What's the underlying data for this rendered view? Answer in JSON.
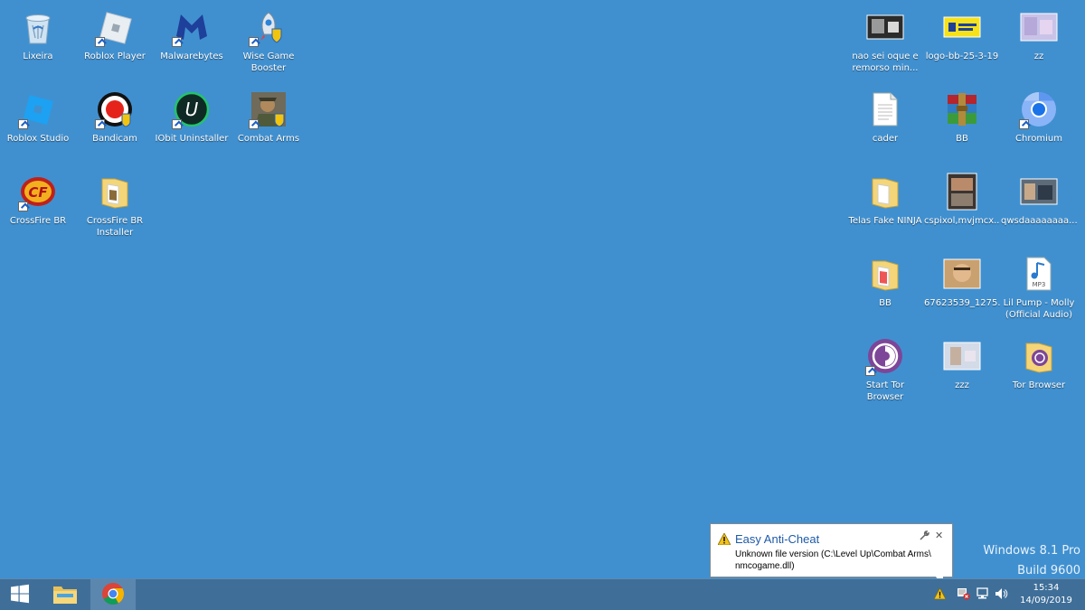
{
  "desktop": {
    "left_icons": [
      {
        "label": "Lixeira",
        "icon": "recycle-bin-icon"
      },
      {
        "label": "Roblox Player",
        "icon": "roblox-player-icon"
      },
      {
        "label": "Malwarebytes",
        "icon": "malwarebytes-icon"
      },
      {
        "label": "Wise Game\nBooster",
        "icon": "wise-game-booster-icon"
      },
      {
        "label": "Roblox Studio",
        "icon": "roblox-studio-icon"
      },
      {
        "label": "Bandicam",
        "icon": "bandicam-icon"
      },
      {
        "label": "IObit Uninstaller",
        "icon": "iobit-uninstaller-icon"
      },
      {
        "label": "Combat Arms",
        "icon": "combat-arms-icon"
      },
      {
        "label": "CrossFire BR",
        "icon": "crossfire-icon"
      },
      {
        "label": "CrossFire BR\nInstaller",
        "icon": "folder-icon"
      }
    ],
    "right_icons": [
      {
        "label": "nao sei oque e\nremorso min...",
        "icon": "image-thumbnail-icon"
      },
      {
        "label": "logo-bb-25-3-19",
        "icon": "banco-do-brasil-logo-icon"
      },
      {
        "label": "zz",
        "icon": "image-thumbnail-icon"
      },
      {
        "label": "cader",
        "icon": "text-file-icon"
      },
      {
        "label": "BB",
        "icon": "winrar-archive-icon"
      },
      {
        "label": "Chromium",
        "icon": "chromium-icon"
      },
      {
        "label": "Telas Fake NINJA",
        "icon": "folder-icon"
      },
      {
        "label": "cspixol,mvjmcx...",
        "icon": "image-thumbnail-icon"
      },
      {
        "label": "qwsdaaaaaaaa...",
        "icon": "image-thumbnail-icon"
      },
      {
        "label": "BB",
        "icon": "folder-icon"
      },
      {
        "label": "67623539_1275...",
        "icon": "image-thumbnail-icon"
      },
      {
        "label": "Lil Pump - Molly\n(Official Audio)",
        "icon": "mp3-file-icon"
      },
      {
        "label": "Start Tor Browser",
        "icon": "tor-browser-icon"
      },
      {
        "label": "zzz",
        "icon": "image-thumbnail-icon"
      },
      {
        "label": "Tor Browser",
        "icon": "tor-folder-icon"
      }
    ]
  },
  "watermark": {
    "line1": "Windows 8.1 Pro",
    "line2": "Build 9600"
  },
  "notification": {
    "title": "Easy Anti-Cheat",
    "message": "Unknown file version (C:\\Level Up\\Combat Arms\\ nmcogame.dll)",
    "warning_icon": "warning-icon",
    "pin_icon": "wrench-icon",
    "close_label": "✕"
  },
  "taskbar": {
    "start_icon": "windows-start-icon",
    "pinned": [
      {
        "name": "file-explorer",
        "icon": "file-explorer-icon"
      },
      {
        "name": "chrome",
        "icon": "chrome-icon"
      }
    ],
    "tray_icons": [
      "warning-icon",
      "action-center-icon",
      "network-icon",
      "volume-icon"
    ],
    "clock": {
      "time": "15:34",
      "date": "14/09/2019"
    }
  },
  "colors": {
    "desktop_bg": "#4090d0",
    "taskbar_bg": "#3f6f99",
    "notification_title": "#1e5aa8"
  }
}
